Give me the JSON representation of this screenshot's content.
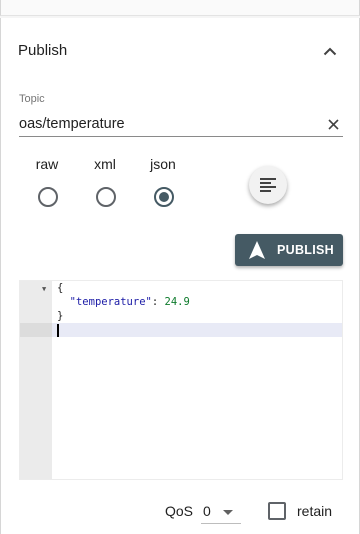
{
  "panel": {
    "title": "Publish"
  },
  "topic": {
    "label": "Topic",
    "value": "oas/temperature"
  },
  "format": {
    "options": [
      "raw",
      "xml",
      "json"
    ],
    "selected": "json"
  },
  "publish_button": {
    "label": "PUBLISH"
  },
  "editor": {
    "lines": [
      "{",
      "  \"temperature\": 24.9",
      "}",
      ""
    ],
    "key": "\"temperature\"",
    "value": "24.9"
  },
  "qos": {
    "label": "QoS",
    "value": "0"
  },
  "retain": {
    "label": "retain",
    "checked": false
  },
  "colors": {
    "accent": "#455a64",
    "active_line": "#e8eaf6",
    "gutter": "#ebebeb"
  },
  "icons": {
    "collapse": "chevron-up-icon",
    "clear": "close-icon",
    "format": "align-left-icon",
    "publish": "navigation-arrow-icon",
    "qos_dropdown": "caret-down-icon"
  }
}
